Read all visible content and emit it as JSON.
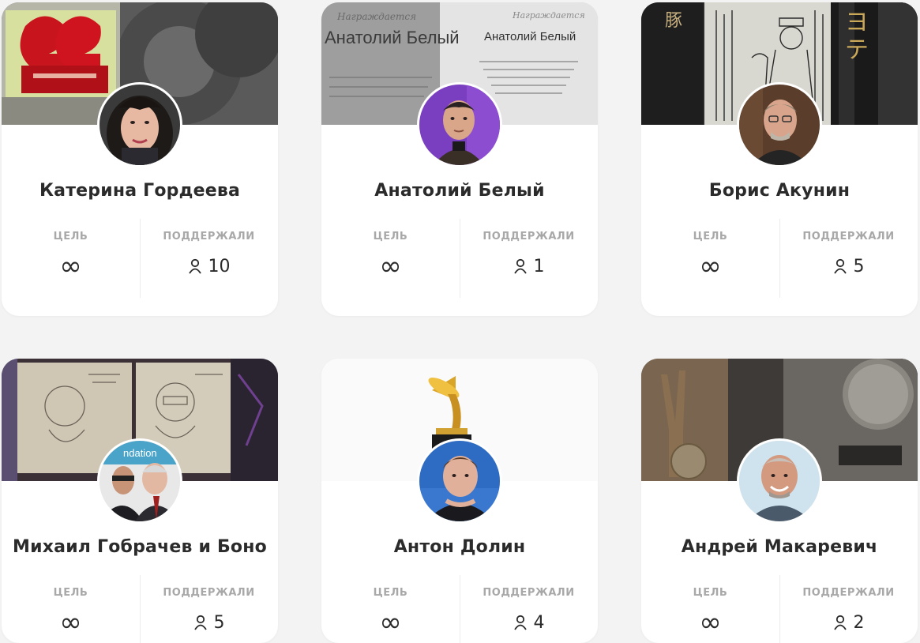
{
  "cards": [
    {
      "name": "Катерина Гордеева",
      "goal_label": "ЦЕЛЬ",
      "goal_value": "∞",
      "supporters_label": "ПОДДЕРЖАЛИ",
      "supporters_count": "10",
      "cover_icon": "red-award-statue",
      "avatar_icon": "woman-portrait"
    },
    {
      "name": "Анатолий Белый",
      "goal_label": "ЦЕЛЬ",
      "goal_value": "∞",
      "supporters_label": "ПОДДЕРЖАЛИ",
      "supporters_count": "1",
      "cover_icon": "diploma-certificate",
      "avatar_icon": "man-portrait",
      "cover_text": {
        "title": "Анатолий Белый",
        "subtitle": "Награждается"
      }
    },
    {
      "name": "Борис Акунин",
      "goal_label": "ЦЕЛЬ",
      "goal_value": "∞",
      "supporters_label": "ПОДДЕРЖАЛИ",
      "supporters_count": "5",
      "cover_icon": "engraving-book",
      "avatar_icon": "man-glasses-portrait"
    },
    {
      "name": "Михаил Гобрачев и Боно",
      "goal_label": "ЦЕЛЬ",
      "goal_value": "∞",
      "supporters_label": "ПОДДЕРЖАЛИ",
      "supporters_count": "5",
      "cover_icon": "framed-sketches",
      "avatar_icon": "two-men-photo"
    },
    {
      "name": "Антон Долин",
      "goal_label": "ЦЕЛЬ",
      "goal_value": "∞",
      "supporters_label": "ПОДДЕРЖАЛИ",
      "supporters_count": "4",
      "cover_icon": "golden-gramophone",
      "avatar_icon": "man-portrait"
    },
    {
      "name": "Андрей Макаревич",
      "goal_label": "ЦЕЛЬ",
      "goal_value": "∞",
      "supporters_label": "ПОДДЕРЖАЛИ",
      "supporters_count": "2",
      "cover_icon": "bronze-hand-medal",
      "avatar_icon": "man-smiling-portrait"
    }
  ],
  "colors": {
    "page_background": "#f3f3f4",
    "card_background": "#ffffff",
    "name_text": "#2b2b2b",
    "label_text": "#a8a8a8"
  }
}
